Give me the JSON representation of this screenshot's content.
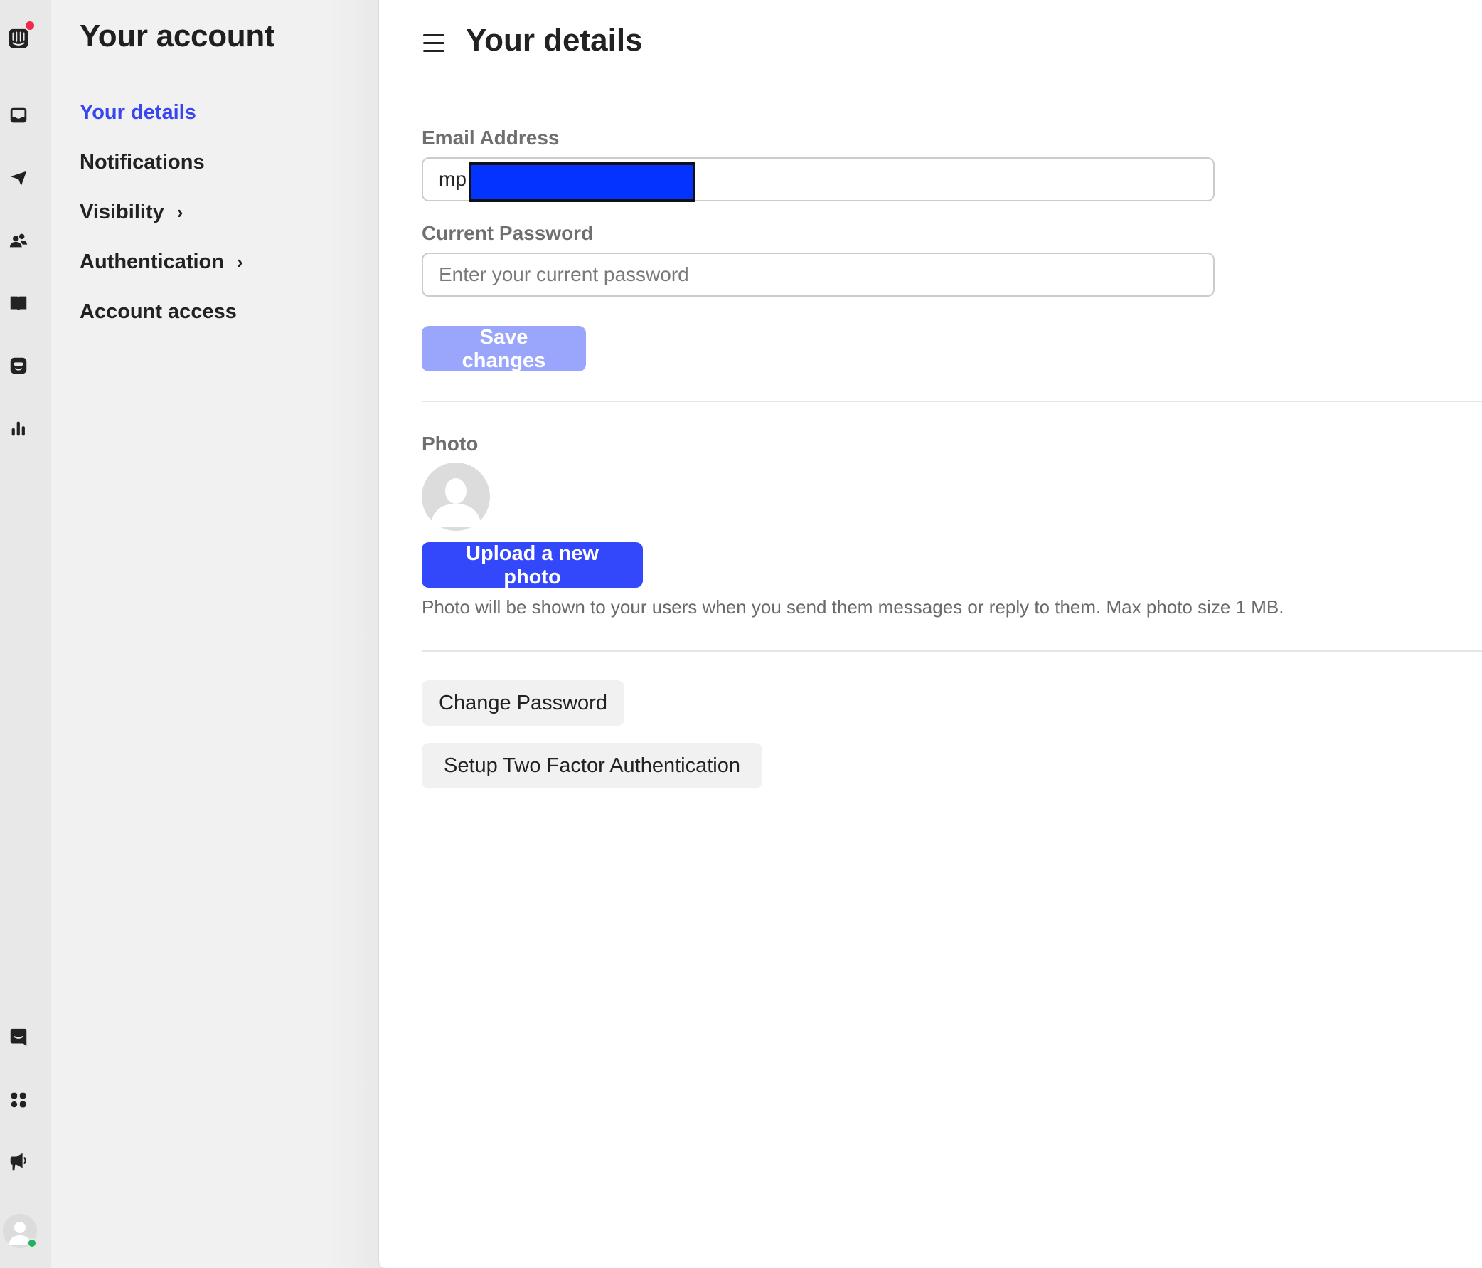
{
  "rail": {
    "items": [
      {
        "name": "logo",
        "icon": "intercom-logo-icon",
        "has_notification": true,
        "notification_color": "#f1284a"
      },
      {
        "name": "inbox",
        "icon": "inbox-icon"
      },
      {
        "name": "outbound",
        "icon": "paper-plane-icon"
      },
      {
        "name": "contacts",
        "icon": "people-icon"
      },
      {
        "name": "articles",
        "icon": "book-icon"
      },
      {
        "name": "fin",
        "icon": "bot-icon"
      },
      {
        "name": "reports",
        "icon": "bar-chart-icon"
      },
      {
        "name": "messenger",
        "icon": "chat-bubble-icon"
      },
      {
        "name": "apps",
        "icon": "apps-grid-icon"
      },
      {
        "name": "announcements",
        "icon": "megaphone-icon"
      }
    ],
    "user_status": "online",
    "status_color": "#1fb35a"
  },
  "subnav": {
    "title": "Your account",
    "items": [
      {
        "label": "Your details",
        "active": true,
        "has_chevron": false
      },
      {
        "label": "Notifications",
        "active": false,
        "has_chevron": false
      },
      {
        "label": "Visibility",
        "active": false,
        "has_chevron": true
      },
      {
        "label": "Authentication",
        "active": false,
        "has_chevron": true
      },
      {
        "label": "Account access",
        "active": false,
        "has_chevron": false
      }
    ],
    "chevron": "›"
  },
  "main": {
    "title": "Your details",
    "email": {
      "label": "Email Address",
      "value": "mp",
      "redacted": true
    },
    "password": {
      "label": "Current Password",
      "value": "",
      "placeholder": "Enter your current password"
    },
    "save_label": "Save changes",
    "photo": {
      "label": "Photo",
      "upload_label": "Upload a new photo",
      "helper": "Photo will be shown to your users when you send them messages or reply to them. Max photo size 1 MB."
    },
    "change_password_label": "Change Password",
    "two_factor_label": "Setup Two Factor Authentication"
  },
  "colors": {
    "accent": "#3448fb",
    "accent_disabled": "#9aa6fb",
    "active_nav": "#3845f1",
    "redaction": "#0433ff"
  }
}
